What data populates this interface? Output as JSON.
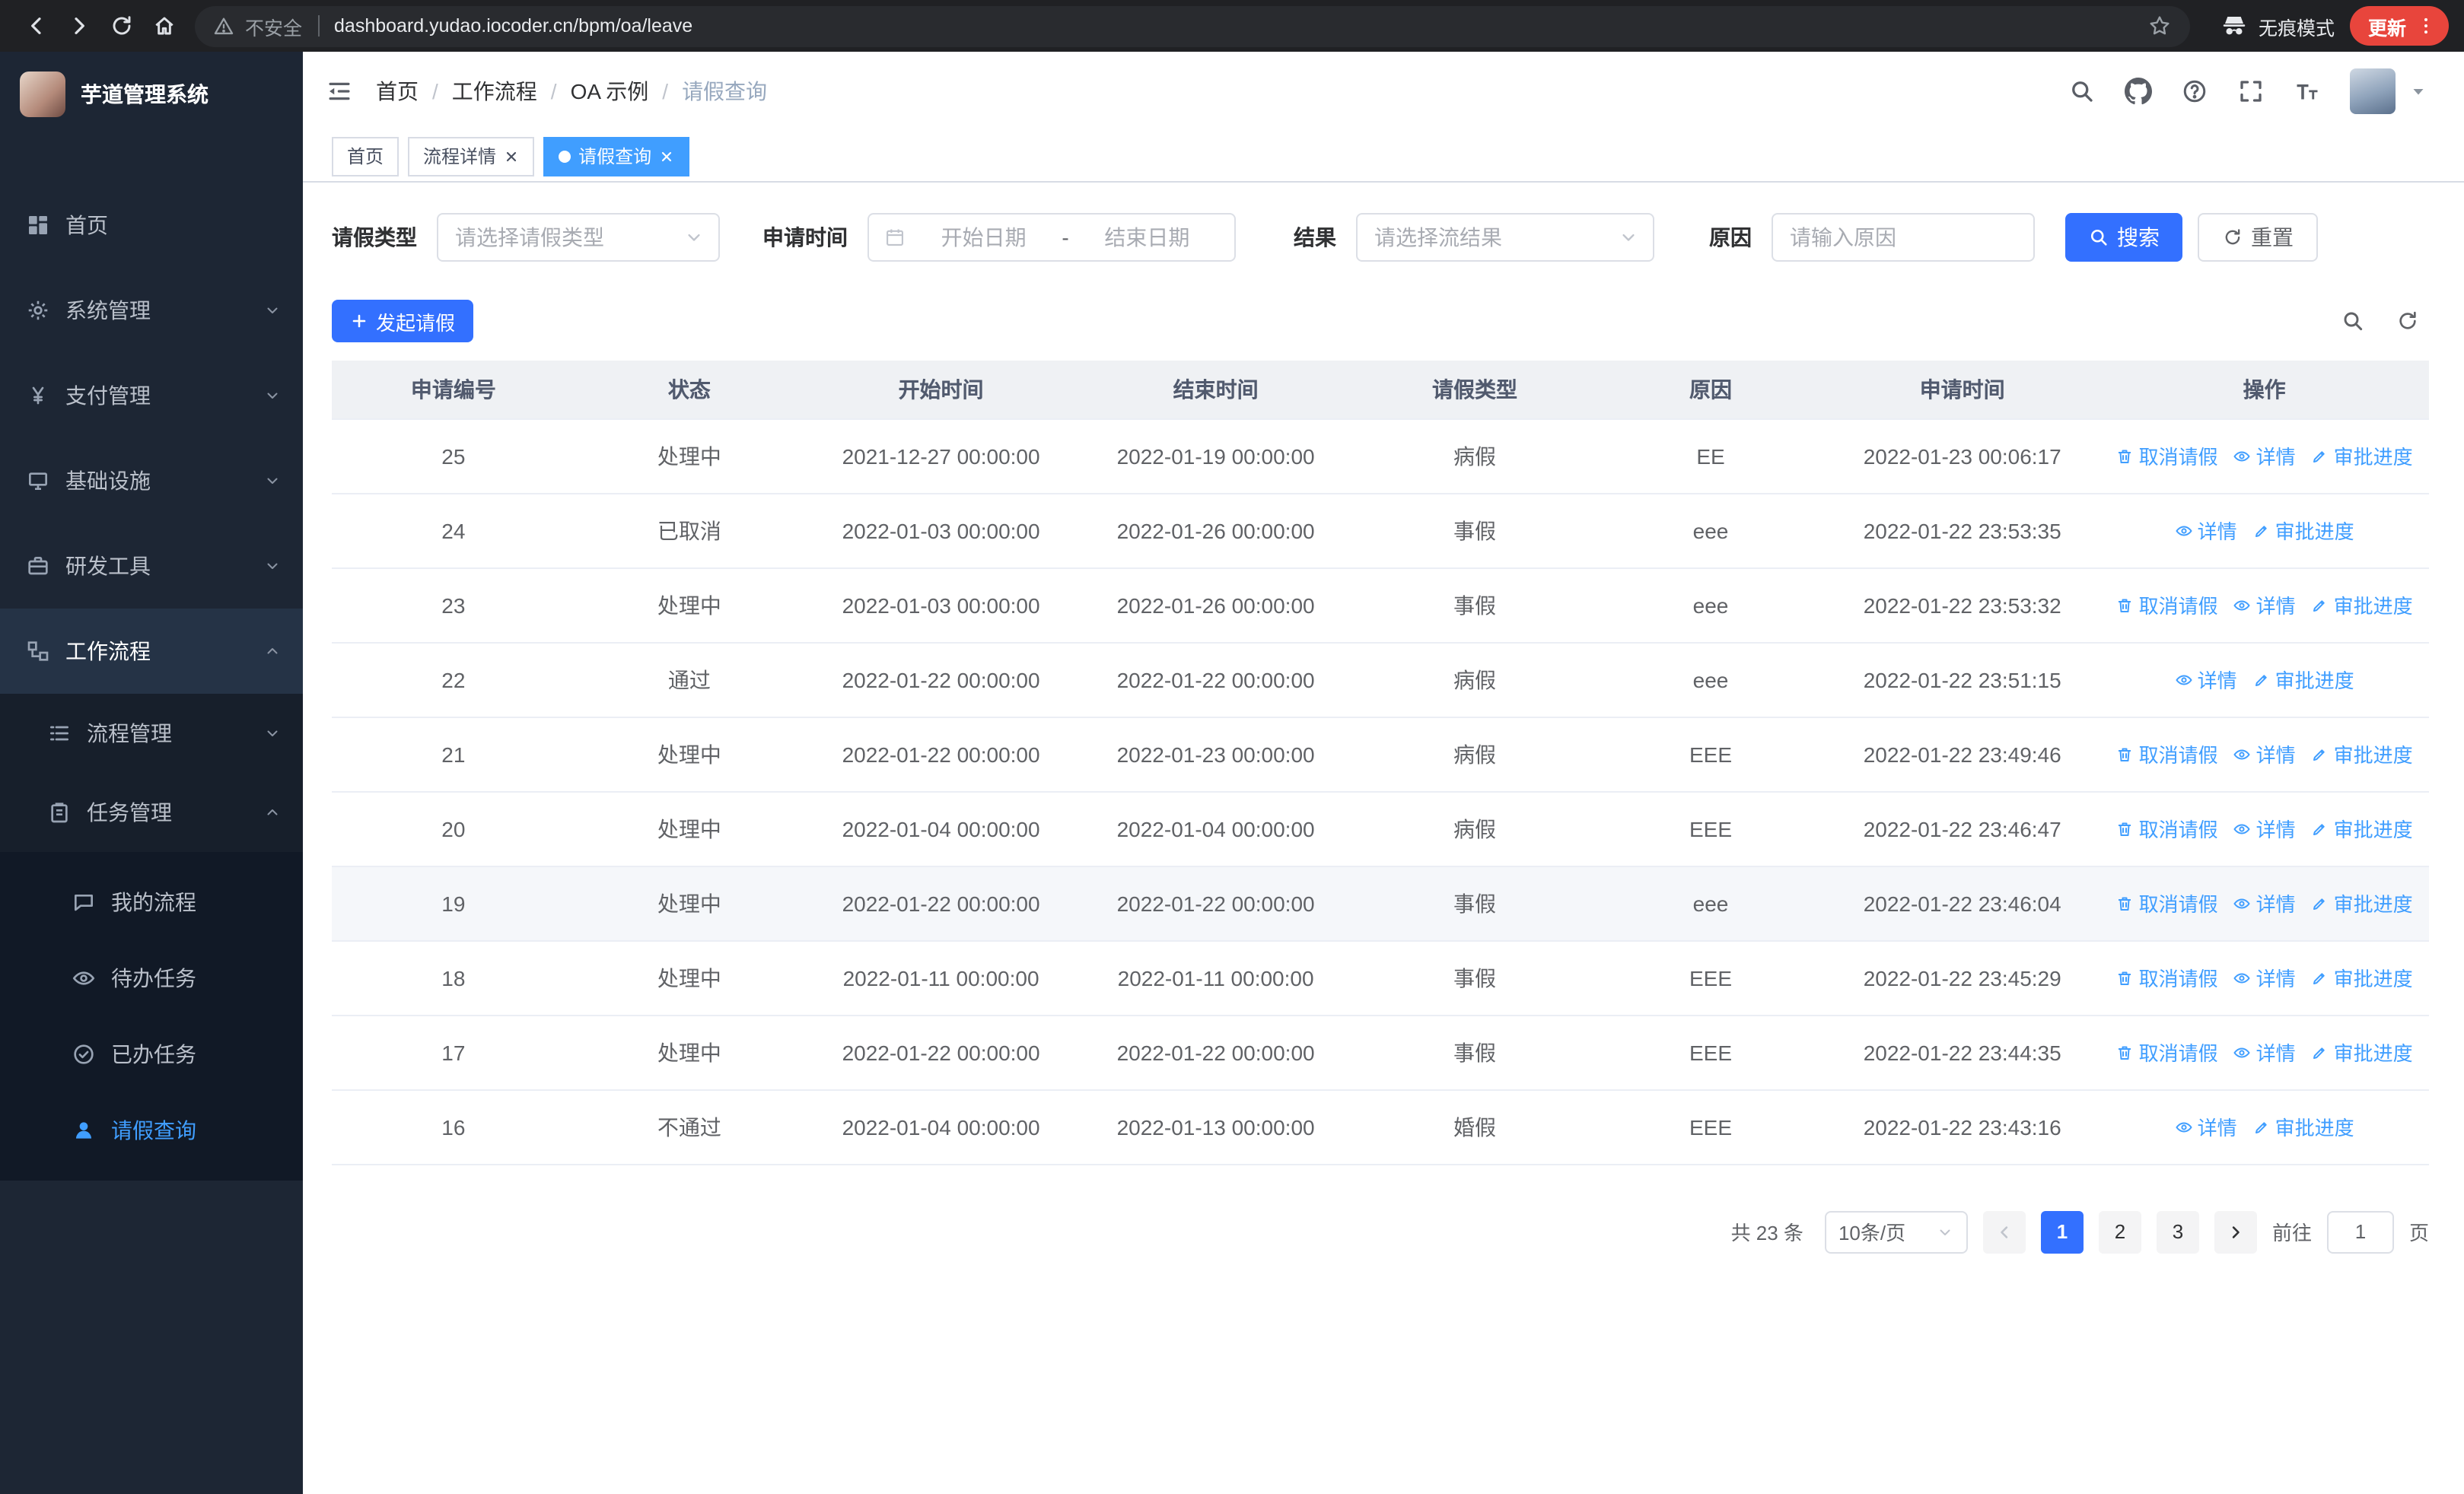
{
  "browser": {
    "nav_icons": [
      "back-icon",
      "forward-icon",
      "reload-icon",
      "home-icon"
    ],
    "security_chip": "不安全",
    "url": "dashboard.yudao.iocoder.cn/bpm/oa/leave",
    "incognito_label": "无痕模式",
    "update_label": "更新"
  },
  "app": {
    "logo_title": "芋道管理系统"
  },
  "sidebar": {
    "menu": [
      {
        "label": "首页",
        "icon": "dashboard-icon"
      },
      {
        "label": "系统管理",
        "icon": "gear-icon"
      },
      {
        "label": "支付管理",
        "icon": "yen-icon"
      },
      {
        "label": "基础设施",
        "icon": "infra-icon"
      },
      {
        "label": "研发工具",
        "icon": "tools-icon"
      },
      {
        "label": "工作流程",
        "icon": "workflow-icon"
      }
    ],
    "workflow_children": [
      {
        "label": "流程管理",
        "icon": "process-icon"
      },
      {
        "label": "任务管理",
        "icon": "task-icon"
      }
    ],
    "task_children": [
      {
        "label": "我的流程",
        "icon": "chat-icon"
      },
      {
        "label": "待办任务",
        "icon": "eye-icon"
      },
      {
        "label": "已办任务",
        "icon": "check-icon"
      },
      {
        "label": "请假查询",
        "icon": "user-icon"
      }
    ]
  },
  "header": {
    "breadcrumb": [
      "首页",
      "工作流程",
      "OA 示例",
      "请假查询"
    ],
    "separator": "/",
    "icons": [
      "search-icon",
      "github-icon",
      "question-icon",
      "fullscreen-icon",
      "fontsize-icon"
    ]
  },
  "tabs": [
    {
      "label": "首页",
      "closable": false,
      "active": false
    },
    {
      "label": "流程详情",
      "closable": true,
      "active": false
    },
    {
      "label": "请假查询",
      "closable": true,
      "active": true
    }
  ],
  "filters": {
    "leave_type": {
      "label": "请假类型",
      "placeholder": "请选择请假类型"
    },
    "apply_time": {
      "label": "申请时间",
      "start_placeholder": "开始日期",
      "separator": "-",
      "end_placeholder": "结束日期"
    },
    "result": {
      "label": "结果",
      "placeholder": "请选择流结果"
    },
    "reason": {
      "label": "原因",
      "placeholder": "请输入原因"
    },
    "search_button": "搜索",
    "reset_button": "重置"
  },
  "toolbar": {
    "create_button": "发起请假"
  },
  "table": {
    "columns": [
      "申请编号",
      "状态",
      "开始时间",
      "结束时间",
      "请假类型",
      "原因",
      "申请时间",
      "操作"
    ],
    "op_labels": {
      "cancel": "取消请假",
      "detail": "详情",
      "progress": "审批进度"
    },
    "op_icons": {
      "cancel": "trash-icon",
      "detail": "eye-icon",
      "progress": "edit-icon"
    },
    "rows": [
      {
        "id": "25",
        "status": "处理中",
        "start": "2021-12-27 00:00:00",
        "end": "2022-01-19 00:00:00",
        "type": "病假",
        "reason": "EE",
        "applied": "2022-01-23 00:06:17",
        "ops": [
          "cancel",
          "detail",
          "progress"
        ],
        "hover": false
      },
      {
        "id": "24",
        "status": "已取消",
        "start": "2022-01-03 00:00:00",
        "end": "2022-01-26 00:00:00",
        "type": "事假",
        "reason": "eee",
        "applied": "2022-01-22 23:53:35",
        "ops": [
          "detail",
          "progress"
        ],
        "hover": false
      },
      {
        "id": "23",
        "status": "处理中",
        "start": "2022-01-03 00:00:00",
        "end": "2022-01-26 00:00:00",
        "type": "事假",
        "reason": "eee",
        "applied": "2022-01-22 23:53:32",
        "ops": [
          "cancel",
          "detail",
          "progress"
        ],
        "hover": false
      },
      {
        "id": "22",
        "status": "通过",
        "start": "2022-01-22 00:00:00",
        "end": "2022-01-22 00:00:00",
        "type": "病假",
        "reason": "eee",
        "applied": "2022-01-22 23:51:15",
        "ops": [
          "detail",
          "progress"
        ],
        "hover": false
      },
      {
        "id": "21",
        "status": "处理中",
        "start": "2022-01-22 00:00:00",
        "end": "2022-01-23 00:00:00",
        "type": "病假",
        "reason": "EEE",
        "applied": "2022-01-22 23:49:46",
        "ops": [
          "cancel",
          "detail",
          "progress"
        ],
        "hover": false
      },
      {
        "id": "20",
        "status": "处理中",
        "start": "2022-01-04 00:00:00",
        "end": "2022-01-04 00:00:00",
        "type": "病假",
        "reason": "EEE",
        "applied": "2022-01-22 23:46:47",
        "ops": [
          "cancel",
          "detail",
          "progress"
        ],
        "hover": false
      },
      {
        "id": "19",
        "status": "处理中",
        "start": "2022-01-22 00:00:00",
        "end": "2022-01-22 00:00:00",
        "type": "事假",
        "reason": "eee",
        "applied": "2022-01-22 23:46:04",
        "ops": [
          "cancel",
          "detail",
          "progress"
        ],
        "hover": true
      },
      {
        "id": "18",
        "status": "处理中",
        "start": "2022-01-11 00:00:00",
        "end": "2022-01-11 00:00:00",
        "type": "事假",
        "reason": "EEE",
        "applied": "2022-01-22 23:45:29",
        "ops": [
          "cancel",
          "detail",
          "progress"
        ],
        "hover": false
      },
      {
        "id": "17",
        "status": "处理中",
        "start": "2022-01-22 00:00:00",
        "end": "2022-01-22 00:00:00",
        "type": "事假",
        "reason": "EEE",
        "applied": "2022-01-22 23:44:35",
        "ops": [
          "cancel",
          "detail",
          "progress"
        ],
        "hover": false
      },
      {
        "id": "16",
        "status": "不通过",
        "start": "2022-01-04 00:00:00",
        "end": "2022-01-13 00:00:00",
        "type": "婚假",
        "reason": "EEE",
        "applied": "2022-01-22 23:43:16",
        "ops": [
          "detail",
          "progress"
        ],
        "hover": false
      }
    ]
  },
  "pagination": {
    "total_text": "共 23 条",
    "page_size": "10条/页",
    "pages": [
      "1",
      "2",
      "3"
    ],
    "active_page": "1",
    "goto_label": "前往",
    "goto_value": "1",
    "goto_suffix": "页"
  },
  "colors": {
    "primary_link": "#409eff",
    "button_primary": "#3370ff",
    "sidebar_bg": "#1d2634",
    "chrome_bg": "#202124",
    "update_red": "#e8453c",
    "table_header_bg": "#eff1f4"
  }
}
